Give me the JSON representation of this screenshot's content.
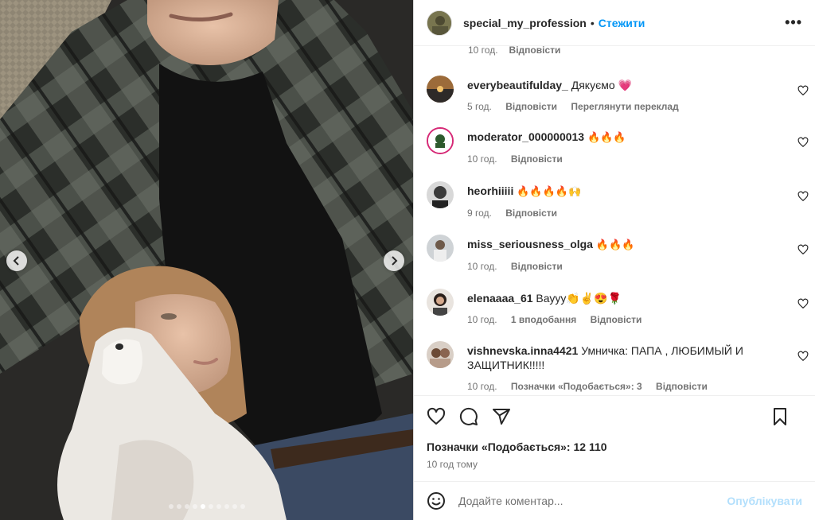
{
  "post": {
    "username": "special_my_profession",
    "separator": "•",
    "follow_label": "Стежити",
    "more_label": "•••"
  },
  "top_meta": {
    "time": "10 год.",
    "reply": "Відповісти"
  },
  "comments": [
    {
      "username": "everybeautifulday_",
      "text": "Дякуємо 💗",
      "time": "5 год.",
      "actions": [
        "Відповісти",
        "Переглянути переклад"
      ]
    },
    {
      "username": "moderator_000000013",
      "text": "🔥🔥🔥",
      "time": "10 год.",
      "actions": [
        "Відповісти"
      ]
    },
    {
      "username": "heorhiiiii",
      "text": "🔥🔥🔥🔥🙌",
      "time": "9 год.",
      "actions": [
        "Відповісти"
      ]
    },
    {
      "username": "miss_seriousness_olga",
      "text": "🔥🔥🔥",
      "time": "10 год.",
      "actions": [
        "Відповісти"
      ]
    },
    {
      "username": "elenaaaa_61",
      "text": "Вауyy👏✌😍🌹",
      "time": "10 год.",
      "actions": [
        "1 вподобання",
        "Відповісти"
      ]
    },
    {
      "username": "vishnevska.inna4421",
      "text": "Умничка: ПАПА , ЛЮБИМЫЙ И ЗАЩИТНИК!!!!!",
      "time": "10 год.",
      "actions": [
        "Позначки «Подобається»: 3",
        "Відповісти"
      ]
    }
  ],
  "likes_label": "Позначки «Подобається»: 12 110",
  "posted_time": "10 год тому",
  "add_comment": {
    "placeholder": "Додайте коментар...",
    "post_label": "Опублікувати"
  },
  "carousel": {
    "slide_count": 10,
    "active_index": 4
  },
  "colors": {
    "accent": "#0095f6",
    "post_disabled": "#b2dffc",
    "muted": "#737373",
    "text": "#262626"
  }
}
